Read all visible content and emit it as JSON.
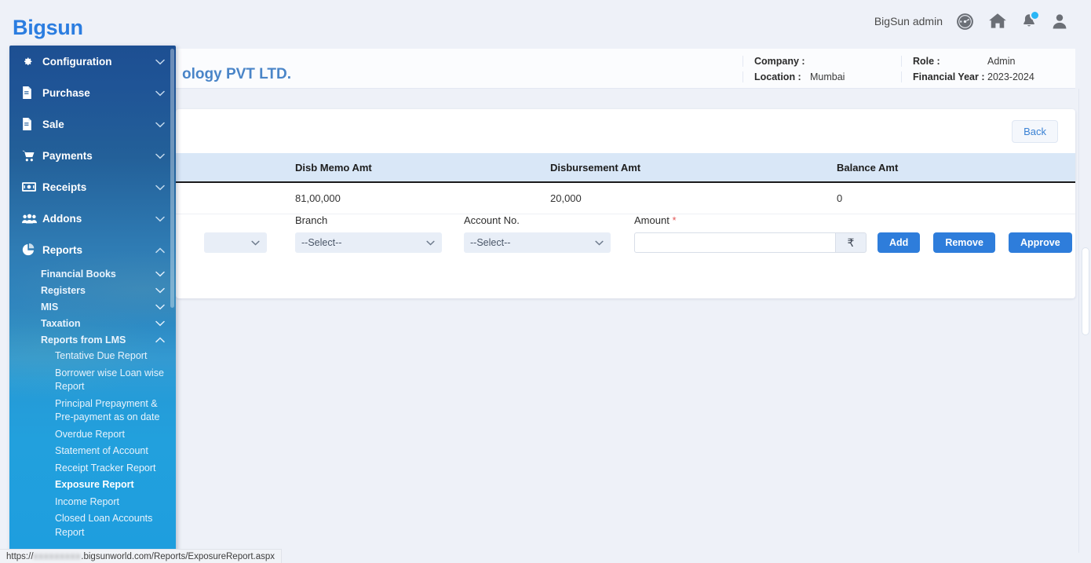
{
  "topbar": {
    "brand": "Bigsun",
    "username": "BigSun admin",
    "icons": [
      "dashboard-icon",
      "home-icon",
      "notification-bell-icon",
      "user-profile-icon"
    ]
  },
  "page_header": {
    "company_title": "ology PVT LTD.",
    "info": {
      "company_label": "Company :",
      "company_value": "",
      "location_label": "Location :",
      "location_value": "Mumbai",
      "role_label": "Role :",
      "role_value": "Admin",
      "financial_year_label": "Financial Year :",
      "financial_year_value": "2023-2024"
    }
  },
  "card": {
    "back_label": "Back",
    "table": {
      "columns": [
        "",
        "Disb Memo Amt",
        "Disbursement Amt",
        "Balance Amt"
      ],
      "rows": [
        [
          "",
          "81,00,000",
          "20,000",
          "0"
        ]
      ]
    },
    "form": {
      "first_select_value": "",
      "branch_label": "Branch",
      "branch_value": "--Select--",
      "account_label": "Account No.",
      "account_value": "--Select--",
      "amount_label": "Amount",
      "amount_required_mark": "*",
      "amount_value": "",
      "amount_placeholder": "",
      "currency_symbol": "₹",
      "add_label": "Add",
      "remove_label": "Remove",
      "approve_label": "Approve"
    }
  },
  "sidebar": {
    "items": [
      {
        "label": "Configuration",
        "icon": "gear-icon",
        "state": "collapsed"
      },
      {
        "label": "Purchase",
        "icon": "document-icon",
        "state": "collapsed"
      },
      {
        "label": "Sale",
        "icon": "document-icon",
        "state": "collapsed"
      },
      {
        "label": "Payments",
        "icon": "cart-icon",
        "state": "collapsed"
      },
      {
        "label": "Receipts",
        "icon": "money-icon",
        "state": "collapsed"
      },
      {
        "label": "Addons",
        "icon": "users-icon",
        "state": "collapsed"
      },
      {
        "label": "Reports",
        "icon": "pie-chart-icon",
        "state": "expanded"
      }
    ],
    "reports_subitems": [
      {
        "label": "Financial Books",
        "state": "collapsed"
      },
      {
        "label": "Registers",
        "state": "collapsed"
      },
      {
        "label": "MIS",
        "state": "collapsed"
      },
      {
        "label": "Taxation",
        "state": "collapsed"
      },
      {
        "label": "Reports from LMS",
        "state": "expanded"
      }
    ],
    "lms_reports": [
      {
        "label": "Tentative Due Report",
        "active": false
      },
      {
        "label": "Borrower wise Loan wise Report",
        "active": false
      },
      {
        "label": "Principal Prepayment & Pre-payment as on date",
        "active": false
      },
      {
        "label": "Overdue Report",
        "active": false
      },
      {
        "label": "Statement of Account",
        "active": false
      },
      {
        "label": "Receipt Tracker Report",
        "active": false
      },
      {
        "label": "Exposure Report",
        "active": true
      },
      {
        "label": "Income Report",
        "active": false
      },
      {
        "label": "Closed Loan Accounts Report",
        "active": false
      }
    ]
  },
  "statusbar": {
    "url_prefix": "https://",
    "url_redacted": "xxxxxxxxx",
    "url_suffix": ".bigsunworld.com/Reports/ExposureReport.aspx"
  },
  "colors": {
    "brand_blue": "#2b7de0",
    "button_blue": "#2e7ddb",
    "table_header": "#d9e7f7",
    "sidebar_top": "#1d4f92",
    "sidebar_bottom": "#1e9ede",
    "required_red": "#e25656",
    "badge_blue": "#29b6f6"
  }
}
